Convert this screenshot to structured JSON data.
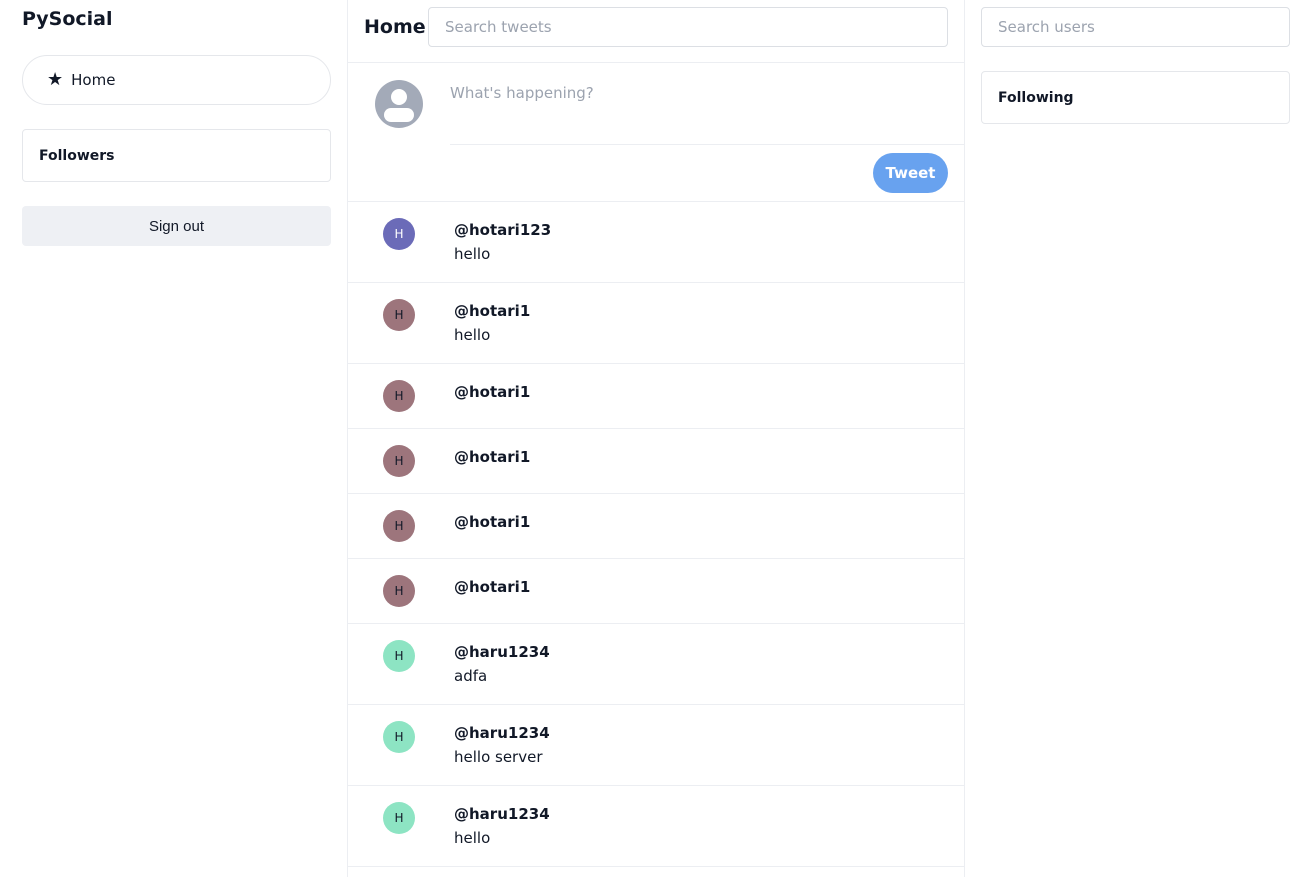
{
  "app": {
    "name": "PySocial"
  },
  "nav": {
    "home_label": "Home",
    "home_icon": "star-icon"
  },
  "sidebar": {
    "followers_label": "Followers",
    "signout_label": "Sign out"
  },
  "header": {
    "title": "Home",
    "search_placeholder": "Search tweets"
  },
  "composer": {
    "placeholder": "What's happening?",
    "tweet_button": "Tweet"
  },
  "tweets": [
    {
      "initial": "H",
      "handle": "@hotari123",
      "text": "hello",
      "avatar_color": "#6b6bb8",
      "initial_color": "#ffffff"
    },
    {
      "initial": "H",
      "handle": "@hotari1",
      "text": "hello",
      "avatar_color": "#9d757c",
      "initial_color": "#111827"
    },
    {
      "initial": "H",
      "handle": "@hotari1",
      "text": "",
      "avatar_color": "#9d757c",
      "initial_color": "#111827"
    },
    {
      "initial": "H",
      "handle": "@hotari1",
      "text": "",
      "avatar_color": "#9d757c",
      "initial_color": "#111827"
    },
    {
      "initial": "H",
      "handle": "@hotari1",
      "text": "",
      "avatar_color": "#9d757c",
      "initial_color": "#111827"
    },
    {
      "initial": "H",
      "handle": "@hotari1",
      "text": "",
      "avatar_color": "#9d757c",
      "initial_color": "#111827"
    },
    {
      "initial": "H",
      "handle": "@haru1234",
      "text": "adfa",
      "avatar_color": "#8de4c3",
      "initial_color": "#111827"
    },
    {
      "initial": "H",
      "handle": "@haru1234",
      "text": "hello server",
      "avatar_color": "#8de4c3",
      "initial_color": "#111827"
    },
    {
      "initial": "H",
      "handle": "@haru1234",
      "text": "hello",
      "avatar_color": "#8de4c3",
      "initial_color": "#111827"
    }
  ],
  "right": {
    "search_placeholder": "Search users",
    "following_label": "Following"
  },
  "colors": {
    "accent": "#68a2ef",
    "border": "#eceef2",
    "signout_bg": "#eef0f4"
  }
}
